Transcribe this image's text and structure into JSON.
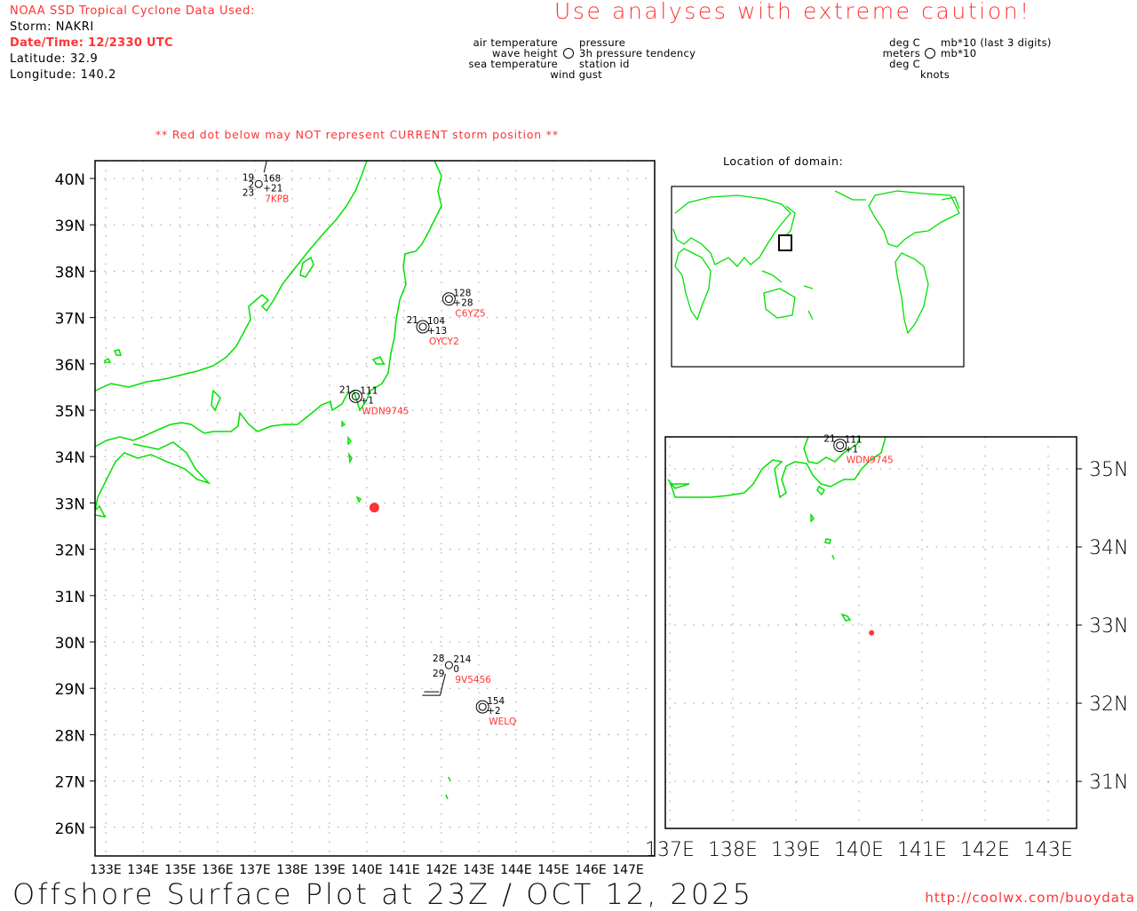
{
  "header": {
    "source": "NOAA SSD Tropical Cyclone Data Used:",
    "storm": "Storm: NAKRI",
    "datetime": "Date/Time: 12/2330 UTC",
    "latitude": "Latitude: 32.9",
    "longitude": "Longitude: 140.2",
    "caution": "Use analyses with extreme caution!",
    "red_dot_note": "** Red dot below may NOT represent CURRENT storm position **"
  },
  "legend": {
    "air_temperature": "air temperature",
    "wave_height": "wave height",
    "sea_temperature": "sea temperature",
    "wind_gust": "wind gust",
    "pressure": "pressure",
    "pressure_tendency": "3h pressure tendency",
    "station_id": "station id",
    "unit_air": "deg C",
    "unit_wave": "meters",
    "unit_sea": "deg C",
    "unit_gust": "knots",
    "unit_pressure": "mb*10 (last 3 digits)",
    "unit_tendency": "mb*10"
  },
  "locator": {
    "title": "Location of domain:"
  },
  "main_map": {
    "lat_labels": [
      "40N",
      "39N",
      "38N",
      "37N",
      "36N",
      "35N",
      "34N",
      "33N",
      "32N",
      "31N",
      "30N",
      "29N",
      "28N",
      "27N",
      "26N"
    ],
    "lat_values": [
      40,
      39,
      38,
      37,
      36,
      35,
      34,
      33,
      32,
      31,
      30,
      29,
      28,
      27,
      26
    ],
    "lon_labels": [
      "133E",
      "134E",
      "135E",
      "136E",
      "137E",
      "138E",
      "139E",
      "140E",
      "141E",
      "142E",
      "143E",
      "144E",
      "145E",
      "146E",
      "147E"
    ],
    "lon_values": [
      133,
      134,
      135,
      136,
      137,
      138,
      139,
      140,
      141,
      142,
      143,
      144,
      145,
      146,
      147
    ]
  },
  "inset_map": {
    "lat_labels": [
      "35N",
      "34N",
      "33N",
      "32N",
      "31N"
    ],
    "lat_values": [
      35,
      34,
      33,
      32,
      31
    ],
    "lon_labels": [
      "137E",
      "138E",
      "139E",
      "140E",
      "141E",
      "142E",
      "143E"
    ],
    "lon_values": [
      137,
      138,
      139,
      140,
      141,
      142,
      143
    ]
  },
  "storm_position": {
    "lat": 32.9,
    "lon": 140.2,
    "color": "#ff3333"
  },
  "stations": [
    {
      "id": "7KPB",
      "lat": 39.88,
      "lon": 137.1,
      "air": "19",
      "wave": "2",
      "sea": "23",
      "pressure": "168",
      "tendency": "+21",
      "gust": "",
      "calm": false
    },
    {
      "id": "C6YZ5",
      "lat": 37.4,
      "lon": 142.2,
      "air": "",
      "wave": "",
      "sea": "",
      "pressure": "128",
      "tendency": "+28",
      "gust": "",
      "calm": true
    },
    {
      "id": "OYCY2",
      "lat": 36.8,
      "lon": 141.5,
      "air": "21",
      "wave": "",
      "sea": "",
      "pressure": "104",
      "tendency": "+13",
      "gust": "",
      "calm": true
    },
    {
      "id": "WDN9745",
      "lat": 35.3,
      "lon": 139.7,
      "air": "21",
      "wave": "",
      "sea": "",
      "pressure": "111",
      "tendency": "+1",
      "gust": "",
      "calm": true
    },
    {
      "id": "9V5456",
      "lat": 29.5,
      "lon": 142.2,
      "air": "28",
      "wave": "",
      "sea": "29",
      "pressure": "214",
      "tendency": "0",
      "gust": "",
      "calm": false
    },
    {
      "id": "WELQ",
      "lat": 28.6,
      "lon": 143.1,
      "air": "",
      "wave": "",
      "sea": "",
      "pressure": "154",
      "tendency": "+2",
      "gust": "",
      "calm": true
    }
  ],
  "footer": {
    "title": "Offshore Surface Plot at 23Z / OCT 12, 2025",
    "url": "http://coolwx.com/buoydata"
  },
  "colors": {
    "land": "#00e000",
    "accent": "#ff3333",
    "grid": "#999999"
  }
}
